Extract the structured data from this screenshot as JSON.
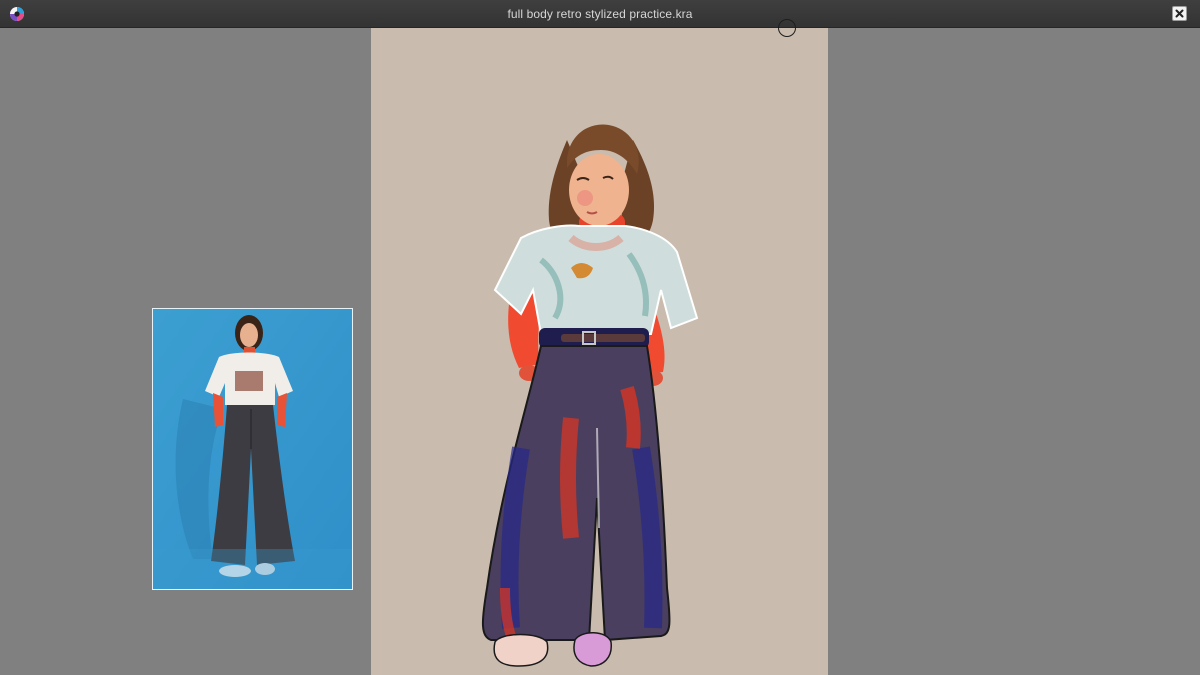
{
  "window": {
    "title": "full body retro stylized practice.kra"
  },
  "icons": {
    "app": "krita-app-icon",
    "close": "close-icon"
  },
  "colors": {
    "titlebar": "#333333",
    "workspace": "#808080",
    "canvas_background": "#c9bbad",
    "reference_background": "#3fa2d4"
  }
}
